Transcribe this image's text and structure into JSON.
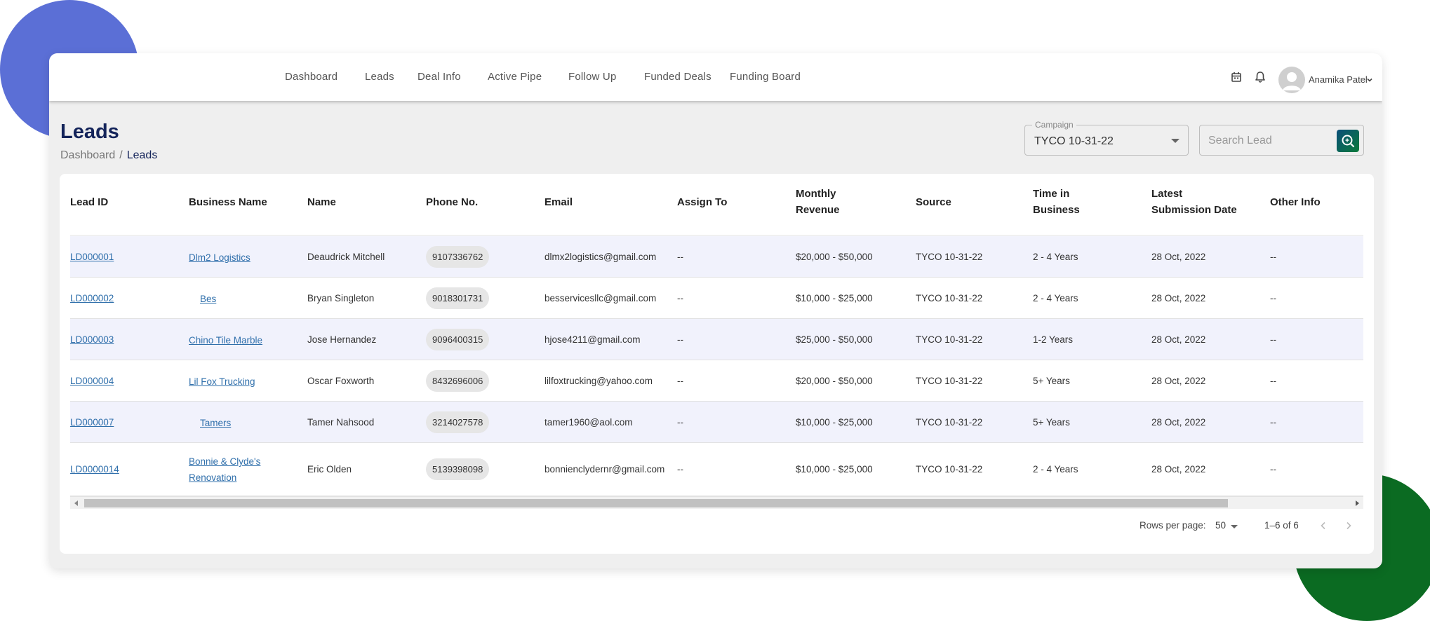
{
  "nav": {
    "items": [
      "Dashboard",
      "Leads",
      "Deal Info",
      "Active Pipe",
      "Follow Up",
      "Funded Deals",
      "Funding Board"
    ],
    "user_name": "Anamika Patel"
  },
  "header": {
    "title": "Leads",
    "breadcrumb": {
      "home": "Dashboard",
      "separator": "/",
      "current": "Leads"
    }
  },
  "filters": {
    "campaign_label": "Campaign",
    "campaign_value": "TYCO 10-31-22",
    "search_placeholder": "Search Lead"
  },
  "table": {
    "columns": [
      [
        "Lead ID"
      ],
      [
        "Business Name"
      ],
      [
        "Name"
      ],
      [
        "Phone No."
      ],
      [
        "Email"
      ],
      [
        "Assign To"
      ],
      [
        "Monthly",
        "Revenue"
      ],
      [
        "Source"
      ],
      [
        "Time in",
        "Business"
      ],
      [
        "Latest",
        "Submission Date"
      ],
      [
        "Other Info"
      ]
    ],
    "rows": [
      {
        "lead_id": "LD000001",
        "business": [
          "Dlm2 Logistics"
        ],
        "name": "Deaudrick Mitchell",
        "phone": "9107336762",
        "email": "dlmx2logistics@gmail.com",
        "assign": "--",
        "revenue": "$20,000 - $50,000",
        "source": "TYCO 10-31-22",
        "time": "2 - 4 Years",
        "date": "28 Oct, 2022",
        "other": "--"
      },
      {
        "lead_id": "LD000002",
        "business": [
          "Bes"
        ],
        "name": "Bryan Singleton",
        "phone": "9018301731",
        "email": "besservicesllc@gmail.com",
        "assign": "--",
        "revenue": "$10,000 - $25,000",
        "source": "TYCO 10-31-22",
        "time": "2 - 4 Years",
        "date": "28 Oct, 2022",
        "other": "--"
      },
      {
        "lead_id": "LD000003",
        "business": [
          "Chino Tile Marble"
        ],
        "name": "Jose Hernandez",
        "phone": "9096400315",
        "email": "hjose4211@gmail.com",
        "assign": "--",
        "revenue": "$25,000 - $50,000",
        "source": "TYCO 10-31-22",
        "time": "1-2 Years",
        "date": "28 Oct, 2022",
        "other": "--"
      },
      {
        "lead_id": "LD000004",
        "business": [
          "Lil Fox Trucking"
        ],
        "name": "Oscar Foxworth",
        "phone": "8432696006",
        "email": "lilfoxtrucking@yahoo.com",
        "assign": "--",
        "revenue": "$20,000 - $50,000",
        "source": "TYCO 10-31-22",
        "time": "5+ Years",
        "date": "28 Oct, 2022",
        "other": "--"
      },
      {
        "lead_id": "LD000007",
        "business": [
          "Tamers"
        ],
        "name": "Tamer Nahsood",
        "phone": "3214027578",
        "email": "tamer1960@aol.com",
        "assign": "--",
        "revenue": "$10,000 - $25,000",
        "source": "TYCO 10-31-22",
        "time": "5+ Years",
        "date": "28 Oct, 2022",
        "other": "--"
      },
      {
        "lead_id": "LD0000014",
        "business": [
          "Bonnie & Clyde's",
          "Renovation"
        ],
        "name": "Eric Olden",
        "phone": "5139398098",
        "email": "bonnienclydernr@gmail.com",
        "assign": "--",
        "revenue": "$10,000 - $25,000",
        "source": "TYCO 10-31-22",
        "time": "2 - 4 Years",
        "date": "28 Oct, 2022",
        "other": "--"
      }
    ]
  },
  "pagination": {
    "rows_per_page_label": "Rows per page:",
    "rows_per_page_value": "50",
    "range": "1–6 of 6"
  },
  "colors": {
    "accent_navy": "#14245a",
    "link": "#2f6fab",
    "striped_row": "#f1f2fc",
    "decor_blue": "#5b6fd6",
    "decor_green": "#0b6b22"
  }
}
